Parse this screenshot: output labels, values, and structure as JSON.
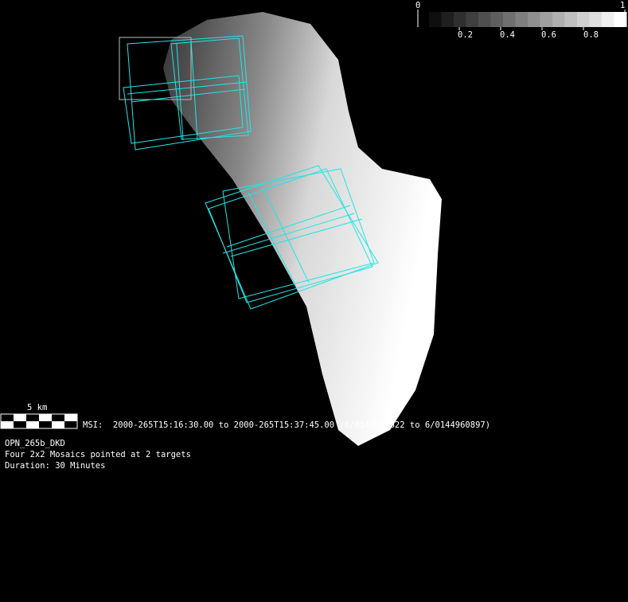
{
  "colorbar": {
    "min_label": "0",
    "max_label": "1",
    "ticks": [
      "0.2",
      "0.4",
      "0.6",
      "0.8"
    ],
    "steps": 16
  },
  "scale_bar": {
    "label": "5 km"
  },
  "msi_line": "MSI:  2000-265T15:16:30.00 to 2000-265T15:37:45.00 (6/0144959622 to 6/0144960897)",
  "info": {
    "name": "OPN_265b_DKD",
    "description": "Four 2x2 Mosaics pointed at 2 targets",
    "duration": "Duration: 30 Minutes"
  },
  "colors": {
    "footprint": "#22e5e5",
    "footprint_alt": "#bbbbbb"
  }
}
